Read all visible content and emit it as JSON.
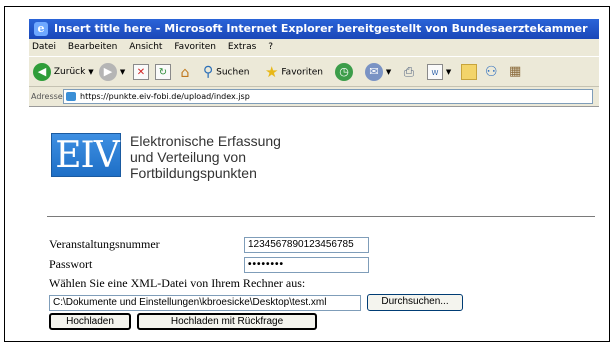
{
  "window": {
    "title": "Insert title here - Microsoft Internet Explorer bereitgestellt von Bundesaerztekammer",
    "icon": "internet-explorer-icon"
  },
  "menu": [
    "Datei",
    "Bearbeiten",
    "Ansicht",
    "Favoriten",
    "Extras",
    "?"
  ],
  "toolbar": {
    "back_label": "Zurück",
    "search_label": "Suchen",
    "favorites_label": "Favoriten"
  },
  "address": {
    "label": "Adresse",
    "url": "https://punkte.eiv-fobi.de/upload/index.jsp"
  },
  "header": {
    "logo_text": "EIV",
    "lines": [
      "Elektronische Erfassung",
      "und Verteilung von",
      "Fortbildungspunkten"
    ]
  },
  "form": {
    "event_number_label": "Veranstaltungsnummer",
    "event_number_value": "1234567890123456785",
    "password_label": "Passwort",
    "password_value": "••••••••",
    "file_prompt": "Wählen Sie eine XML-Datei von Ihrem Rechner aus:",
    "file_path": "C:\\Dokumente und Einstellungen\\kbroesicke\\Desktop\\test.xml",
    "browse_label": "Durchsuchen...",
    "upload_label": "Hochladen",
    "upload_confirm_label": "Hochladen mit Rückfrage"
  },
  "colors": {
    "titlebar": "#1a47b8",
    "chrome": "#ece9d8",
    "logo_blue": "#2a7fd4"
  }
}
